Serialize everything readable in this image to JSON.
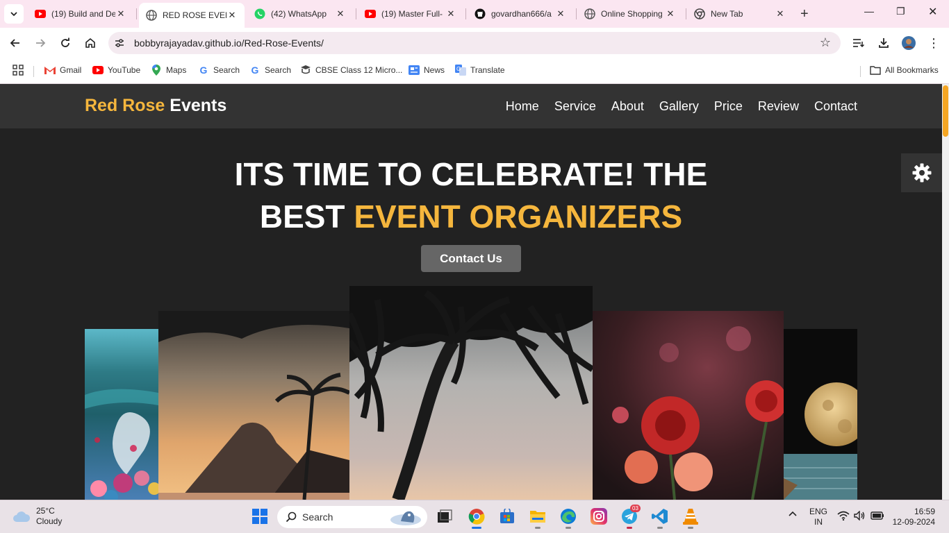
{
  "browser": {
    "tabs": [
      {
        "title": "(19) Build and De",
        "icon": "youtube-icon"
      },
      {
        "title": "RED ROSE EVENTS",
        "icon": "globe-icon",
        "active": true
      },
      {
        "title": "(42) WhatsApp",
        "icon": "whatsapp-icon"
      },
      {
        "title": "(19) Master Full-",
        "icon": "youtube-icon"
      },
      {
        "title": "govardhan666/a",
        "icon": "github-icon"
      },
      {
        "title": "Online Shopping",
        "icon": "globe-icon"
      },
      {
        "title": "New Tab",
        "icon": "chrome-icon"
      }
    ],
    "url": "bobbyrajayadav.github.io/Red-Rose-Events/",
    "bookmarks": [
      {
        "label": "Gmail",
        "icon": "gmail-icon"
      },
      {
        "label": "YouTube",
        "icon": "youtube-icon"
      },
      {
        "label": "Maps",
        "icon": "maps-icon"
      },
      {
        "label": "Search",
        "icon": "google-icon"
      },
      {
        "label": "Search",
        "icon": "google-icon"
      },
      {
        "label": "CBSE Class 12 Micro...",
        "icon": "cbse-icon"
      },
      {
        "label": "News",
        "icon": "news-icon"
      },
      {
        "label": "Translate",
        "icon": "translate-icon"
      }
    ],
    "all_bookmarks": "All Bookmarks"
  },
  "site": {
    "logo_part1": "Red Rose",
    "logo_part2": "Events",
    "nav": [
      "Home",
      "Service",
      "About",
      "Gallery",
      "Price",
      "Review",
      "Contact"
    ],
    "hero_line1": "ITS TIME TO CELEBRATE! THE",
    "hero_line2_plain": "BEST",
    "hero_line2_accent": "EVENT ORGANIZERS",
    "cta": "Contact Us",
    "accent_color": "#f5b63d",
    "gallery": [
      "beach-hearts-image",
      "sunset-mountain-image",
      "palm-tree-image",
      "red-flowers-image",
      "moon-sea-image"
    ]
  },
  "taskbar": {
    "temperature": "25°C",
    "weather": "Cloudy",
    "search_label": "Search",
    "lang1": "ENG",
    "lang2": "IN",
    "time": "16:59",
    "date": "12-09-2024",
    "telegram_badge": "03"
  }
}
